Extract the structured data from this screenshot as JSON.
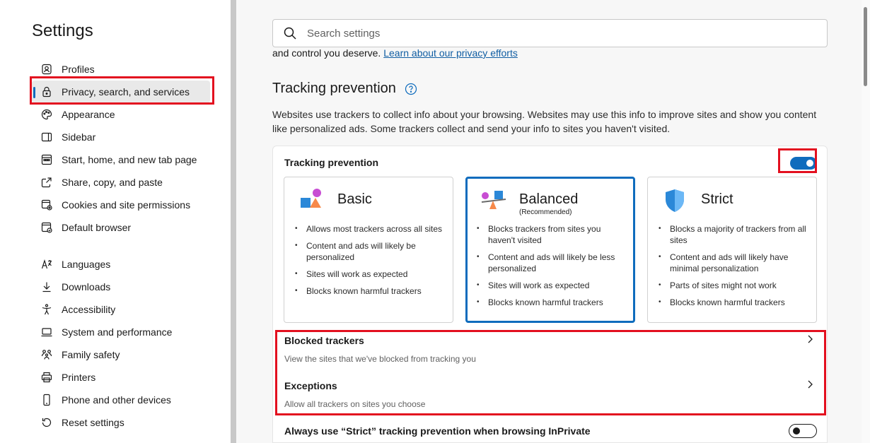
{
  "sidebar": {
    "title": "Settings",
    "items": [
      {
        "label": "Profiles",
        "icon": "profile-icon"
      },
      {
        "label": "Privacy, search, and services",
        "icon": "lock-icon",
        "active": true
      },
      {
        "label": "Appearance",
        "icon": "palette-icon"
      },
      {
        "label": "Sidebar",
        "icon": "sidebar-icon"
      },
      {
        "label": "Start, home, and new tab page",
        "icon": "home-grid-icon"
      },
      {
        "label": "Share, copy, and paste",
        "icon": "share-icon"
      },
      {
        "label": "Cookies and site permissions",
        "icon": "cookies-icon"
      },
      {
        "label": "Default browser",
        "icon": "browser-icon"
      },
      {
        "label": "Languages",
        "icon": "languages-icon"
      },
      {
        "label": "Downloads",
        "icon": "download-icon"
      },
      {
        "label": "Accessibility",
        "icon": "accessibility-icon"
      },
      {
        "label": "System and performance",
        "icon": "laptop-icon"
      },
      {
        "label": "Family safety",
        "icon": "family-icon"
      },
      {
        "label": "Printers",
        "icon": "printer-icon"
      },
      {
        "label": "Phone and other devices",
        "icon": "phone-icon"
      },
      {
        "label": "Reset settings",
        "icon": "reset-icon"
      }
    ]
  },
  "search": {
    "placeholder": "Search settings"
  },
  "partial_text": {
    "prefix": "and control you deserve.",
    "link": "Learn about our privacy efforts"
  },
  "tracking": {
    "title": "Tracking prevention",
    "description": "Websites use trackers to collect info about your browsing. Websites may use this info to improve sites and show you content like personalized ads. Some trackers collect and send your info to sites you haven't visited.",
    "card_title": "Tracking prevention",
    "enabled": true,
    "levels": [
      {
        "name": "Basic",
        "sub": "",
        "bullets": [
          "Allows most trackers across all sites",
          "Content and ads will likely be personalized",
          "Sites will work as expected",
          "Blocks known harmful trackers"
        ]
      },
      {
        "name": "Balanced",
        "sub": "(Recommended)",
        "selected": true,
        "bullets": [
          "Blocks trackers from sites you haven't visited",
          "Content and ads will likely be less personalized",
          "Sites will work as expected",
          "Blocks known harmful trackers"
        ]
      },
      {
        "name": "Strict",
        "sub": "",
        "bullets": [
          "Blocks a majority of trackers from all sites",
          "Content and ads will likely have minimal personalization",
          "Parts of sites might not work",
          "Blocks known harmful trackers"
        ]
      }
    ],
    "blocked": {
      "title": "Blocked trackers",
      "sub": "View the sites that we've blocked from tracking you"
    },
    "exceptions": {
      "title": "Exceptions",
      "sub": "Allow all trackers on sites you choose"
    },
    "inprivate": {
      "title": "Always use “Strict” tracking prevention when browsing InPrivate",
      "enabled": false
    }
  },
  "colors": {
    "accent": "#0f6cbd",
    "highlight": "#e3101f"
  }
}
